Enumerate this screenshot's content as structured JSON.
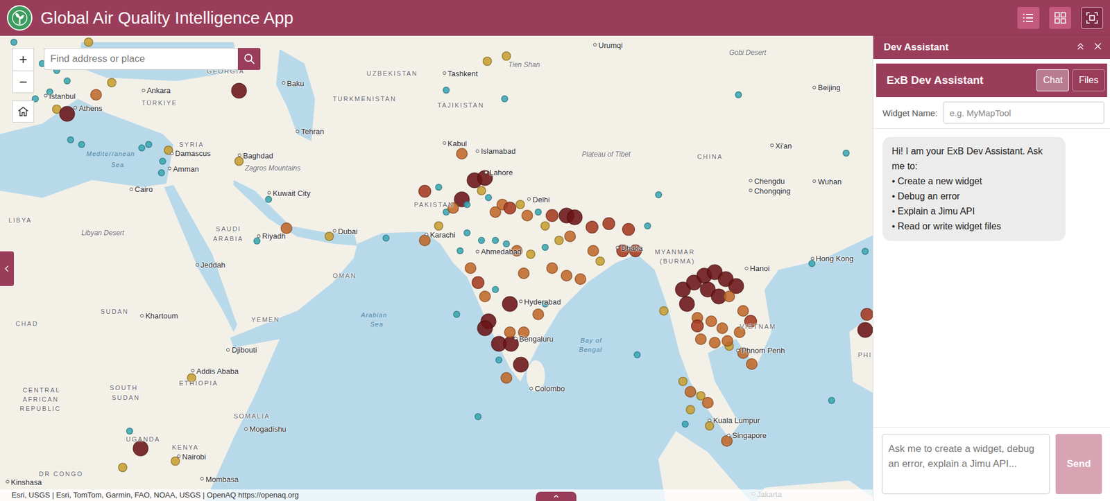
{
  "app": {
    "title": "Global Air Quality Intelligence App"
  },
  "header_buttons": [
    {
      "selected": false
    },
    {
      "selected": false
    },
    {
      "selected": true
    }
  ],
  "map": {
    "search": {
      "placeholder": "Find address or place"
    },
    "zoom_in": "+",
    "zoom_out": "−",
    "attribution": "Esri, USGS | Esri, TomTom, Garmin, FAO, NOAA, USGS | OpenAQ https://openaq.org",
    "labels": [
      {
        "text": "Istanbul",
        "kind": "city"
      },
      {
        "text": "Ankara",
        "kind": "city"
      },
      {
        "text": "TÜRKIYE",
        "kind": "country"
      },
      {
        "text": "GEORGIA",
        "kind": "country"
      },
      {
        "text": "Baku",
        "kind": "city"
      },
      {
        "text": "Athens",
        "kind": "city"
      },
      {
        "text": "Mediterranean",
        "kind": "water"
      },
      {
        "text": "Sea",
        "kind": "water"
      },
      {
        "text": "SYRIA",
        "kind": "country"
      },
      {
        "text": "Damascus",
        "kind": "city"
      },
      {
        "text": "Amman",
        "kind": "city"
      },
      {
        "text": "Cairo",
        "kind": "city"
      },
      {
        "text": "Baghdad",
        "kind": "city"
      },
      {
        "text": "Zagros Mountains",
        "kind": "region"
      },
      {
        "text": "Tehran",
        "kind": "city"
      },
      {
        "text": "TURKMENISTAN",
        "kind": "country"
      },
      {
        "text": "UZBEKISTAN",
        "kind": "country"
      },
      {
        "text": "Tashkent",
        "kind": "city"
      },
      {
        "text": "TAJIKISTAN",
        "kind": "country"
      },
      {
        "text": "Tien Shan",
        "kind": "region"
      },
      {
        "text": "Urumqi",
        "kind": "city"
      },
      {
        "text": "Gobi Desert",
        "kind": "region"
      },
      {
        "text": "Kabul",
        "kind": "city"
      },
      {
        "text": "Islamabad",
        "kind": "city"
      },
      {
        "text": "Lahore",
        "kind": "city"
      },
      {
        "text": "Delhi",
        "kind": "city"
      },
      {
        "text": "PAKISTAN",
        "kind": "country"
      },
      {
        "text": "Karachi",
        "kind": "city"
      },
      {
        "text": "Ahmedabad",
        "kind": "city"
      },
      {
        "text": "Hyderabad",
        "kind": "city"
      },
      {
        "text": "Bengaluru",
        "kind": "city"
      },
      {
        "text": "Colombo",
        "kind": "city"
      },
      {
        "text": "Kuwait City",
        "kind": "city"
      },
      {
        "text": "Riyadh",
        "kind": "city"
      },
      {
        "text": "SAUDI",
        "kind": "country"
      },
      {
        "text": "ARABIA",
        "kind": "country"
      },
      {
        "text": "Dubai",
        "kind": "city"
      },
      {
        "text": "OMAN",
        "kind": "country"
      },
      {
        "text": "Jeddah",
        "kind": "city"
      },
      {
        "text": "Arabian",
        "kind": "water"
      },
      {
        "text": "Sea",
        "kind": "water"
      },
      {
        "text": "YEMEN",
        "kind": "country"
      },
      {
        "text": "Libyan Desert",
        "kind": "region"
      },
      {
        "text": "LIBYA",
        "kind": "country"
      },
      {
        "text": "SUDAN",
        "kind": "country"
      },
      {
        "text": "Khartoum",
        "kind": "city"
      },
      {
        "text": "CHAD",
        "kind": "country"
      },
      {
        "text": "Djibouti",
        "kind": "city"
      },
      {
        "text": "Addis Ababa",
        "kind": "city"
      },
      {
        "text": "ETHIOPIA",
        "kind": "country"
      },
      {
        "text": "SOUTH",
        "kind": "country"
      },
      {
        "text": "SUDAN",
        "kind": "country"
      },
      {
        "text": "CENTRAL",
        "kind": "country"
      },
      {
        "text": "AFRICAN",
        "kind": "country"
      },
      {
        "text": "REPUBLIC",
        "kind": "country"
      },
      {
        "text": "SOMALIA",
        "kind": "country"
      },
      {
        "text": "Mogadishu",
        "kind": "city"
      },
      {
        "text": "UGANDA",
        "kind": "country"
      },
      {
        "text": "KENYA",
        "kind": "country"
      },
      {
        "text": "Nairobi",
        "kind": "city"
      },
      {
        "text": "DR CONGO",
        "kind": "country"
      },
      {
        "text": "Kinshasa",
        "kind": "city"
      },
      {
        "text": "Mombasa",
        "kind": "city"
      },
      {
        "text": "Plateau of Tibet",
        "kind": "region"
      },
      {
        "text": "CHINA",
        "kind": "country"
      },
      {
        "text": "Xi'an",
        "kind": "city"
      },
      {
        "text": "Beijing",
        "kind": "city"
      },
      {
        "text": "Chengdu",
        "kind": "city"
      },
      {
        "text": "Chongqing",
        "kind": "city"
      },
      {
        "text": "Wuhan",
        "kind": "city"
      },
      {
        "text": "Dhaka",
        "kind": "city"
      },
      {
        "text": "MYANMAR",
        "kind": "country"
      },
      {
        "text": "(BURMA)",
        "kind": "country"
      },
      {
        "text": "Bay of",
        "kind": "water"
      },
      {
        "text": "Bengal",
        "kind": "water"
      },
      {
        "text": "Hanoi",
        "kind": "city"
      },
      {
        "text": "Hong Kong",
        "kind": "city"
      },
      {
        "text": "VIETNAM",
        "kind": "country"
      },
      {
        "text": "Phnom Penh",
        "kind": "city"
      },
      {
        "text": "Kuala Lumpur",
        "kind": "city"
      },
      {
        "text": "Singapore",
        "kind": "city"
      },
      {
        "text": "Jakarta",
        "kind": "city"
      },
      {
        "text": "PHI",
        "kind": "country"
      }
    ],
    "markers": [
      {
        "color": "#3aa9b4"
      },
      {
        "color": "#3aa9b4"
      },
      {
        "color": "#3aa9b4"
      },
      {
        "color": "#3aa9b4"
      },
      {
        "color": "#3aa9b4"
      },
      {
        "color": "#3aa9b4"
      },
      {
        "color": "#3aa9b4"
      },
      {
        "color": "#3aa9b4"
      },
      {
        "color": "#c9a032"
      },
      {
        "color": "#6b1517"
      },
      {
        "color": "#3aa9b4"
      },
      {
        "color": "#3aa9b4"
      },
      {
        "color": "#c9a032"
      },
      {
        "color": "#c9a032"
      },
      {
        "color": "#c0692a"
      },
      {
        "color": "#3aa9b4"
      },
      {
        "color": "#3aa9b4"
      },
      {
        "color": "#c9a032"
      },
      {
        "color": "#3aa9b4"
      },
      {
        "color": "#3aa9b4"
      },
      {
        "color": "#6b1517"
      },
      {
        "color": "#c9a032"
      },
      {
        "color": "#3aa9b4"
      },
      {
        "color": "#c0692a"
      },
      {
        "color": "#c9a032"
      },
      {
        "color": "#3aa9b4"
      },
      {
        "color": "#3aa9b4"
      },
      {
        "color": "#c9a032"
      },
      {
        "color": "#c9a032"
      },
      {
        "color": "#3aa9b4"
      },
      {
        "color": "#3aa9b4"
      },
      {
        "color": "#3aa9b4"
      },
      {
        "color": "#3aa9b4"
      },
      {
        "color": "#3aa9b4"
      },
      {
        "color": "#3aa9b4"
      },
      {
        "color": "#c0692a"
      },
      {
        "color": "#a63a22"
      },
      {
        "color": "#6b1517"
      },
      {
        "color": "#6b1517"
      },
      {
        "color": "#6b1517"
      },
      {
        "color": "#3aa9b4"
      },
      {
        "color": "#3aa9b4"
      },
      {
        "color": "#c0692a"
      },
      {
        "color": "#3aa9b4"
      },
      {
        "color": "#c9a032"
      },
      {
        "color": "#3aa9b4"
      },
      {
        "color": "#c0692a"
      },
      {
        "color": "#c0692a"
      },
      {
        "color": "#a63a22"
      },
      {
        "color": "#c9a032"
      },
      {
        "color": "#c0692a"
      },
      {
        "color": "#3aa9b4"
      },
      {
        "color": "#c9a032"
      },
      {
        "color": "#a63a22"
      },
      {
        "color": "#6b1517"
      },
      {
        "color": "#6b1517"
      },
      {
        "color": "#a63a22"
      },
      {
        "color": "#a63a22"
      },
      {
        "color": "#a63a22"
      },
      {
        "color": "#c0692a"
      },
      {
        "color": "#c9a032"
      },
      {
        "color": "#3aa9b4"
      },
      {
        "color": "#c9a032"
      },
      {
        "color": "#c0692a"
      },
      {
        "color": "#3aa9b4"
      },
      {
        "color": "#3aa9b4"
      },
      {
        "color": "#3aa9b4"
      },
      {
        "color": "#3aa9b4"
      },
      {
        "color": "#3aa9b4"
      },
      {
        "color": "#c0692a"
      },
      {
        "color": "#a63a22"
      },
      {
        "color": "#c0692a"
      },
      {
        "color": "#3aa9b4"
      },
      {
        "color": "#6b1517"
      },
      {
        "color": "#6b1517"
      },
      {
        "color": "#6b1517"
      },
      {
        "color": "#6b1517"
      },
      {
        "color": "#6b1517"
      },
      {
        "color": "#6b1517"
      },
      {
        "color": "#c0692a"
      },
      {
        "color": "#c0692a"
      },
      {
        "color": "#c0692a"
      },
      {
        "color": "#c0692a"
      },
      {
        "color": "#c0692a"
      },
      {
        "color": "#c0692a"
      },
      {
        "color": "#c0692a"
      },
      {
        "color": "#3aa9b4"
      },
      {
        "color": "#3aa9b4"
      },
      {
        "color": "#c0692a"
      },
      {
        "color": "#3aa9b4"
      },
      {
        "color": "#c0692a"
      },
      {
        "color": "#3aa9b4"
      },
      {
        "color": "#c9a032"
      },
      {
        "color": "#a63a22"
      },
      {
        "color": "#a63a22"
      },
      {
        "color": "#c9a032"
      },
      {
        "color": "#c0692a"
      },
      {
        "color": "#3aa9b4"
      },
      {
        "color": "#3aa9b4"
      },
      {
        "color": "#6b1517"
      },
      {
        "color": "#6b1517"
      },
      {
        "color": "#6b1517"
      },
      {
        "color": "#6b1517"
      },
      {
        "color": "#6b1517"
      },
      {
        "color": "#6b1517"
      },
      {
        "color": "#6b1517"
      },
      {
        "color": "#6b1517"
      },
      {
        "color": "#6b1517"
      },
      {
        "color": "#c0692a"
      },
      {
        "color": "#c0692a"
      },
      {
        "color": "#a63a22"
      },
      {
        "color": "#c0692a"
      },
      {
        "color": "#c0692a"
      },
      {
        "color": "#c0692a"
      },
      {
        "color": "#c0692a"
      },
      {
        "color": "#c0692a"
      },
      {
        "color": "#c0692a"
      },
      {
        "color": "#c9a032"
      },
      {
        "color": "#c0692a"
      },
      {
        "color": "#c0692a"
      },
      {
        "color": "#c0692a"
      },
      {
        "color": "#a63a22"
      },
      {
        "color": "#c9a032"
      },
      {
        "color": "#c0692a"
      },
      {
        "color": "#c9a032"
      },
      {
        "color": "#c0692a"
      },
      {
        "color": "#c9a032"
      },
      {
        "color": "#c9a032"
      },
      {
        "color": "#c0692a"
      },
      {
        "color": "#c9a032"
      },
      {
        "color": "#3aa9b4"
      },
      {
        "color": "#3aa9b4"
      },
      {
        "color": "#3aa9b4"
      },
      {
        "color": "#a63a22"
      },
      {
        "color": "#6b1517"
      },
      {
        "color": "#6b1517"
      },
      {
        "color": "#3aa9b4"
      },
      {
        "color": "#c9a032"
      },
      {
        "color": "#c9a032"
      },
      {
        "color": "#c9a032"
      }
    ]
  },
  "panel": {
    "title": "Dev Assistant",
    "assistant_title": "ExB Dev Assistant",
    "tabs": [
      {
        "label": "Chat",
        "selected": true
      },
      {
        "label": "Files",
        "selected": false
      }
    ],
    "widget_name": {
      "label": "Widget Name:",
      "placeholder": "e.g. MyMapTool"
    },
    "messages": [
      {
        "lines": [
          "Hi! I am your ExB Dev Assistant. Ask me to:",
          "• Create a new widget",
          "• Debug an error",
          "• Explain a Jimu API",
          "• Read or write widget files"
        ]
      }
    ],
    "input": {
      "placeholder": "Ask me to create a widget, debug an error, explain a Jimu API..."
    },
    "send": {
      "label": "Send",
      "disabled": true
    }
  }
}
